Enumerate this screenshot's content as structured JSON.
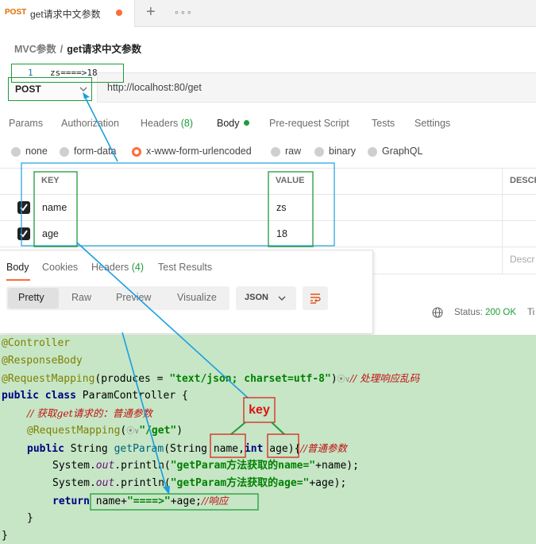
{
  "tab": {
    "method": "POST",
    "title": "get请求中文参数",
    "plus": "+",
    "more": "∘∘∘"
  },
  "breadcrumb": {
    "parent": "MVC参数",
    "separator": "/",
    "current": "get请求中文参数"
  },
  "request": {
    "method": "POST",
    "url": "http://localhost:80/get",
    "tabs": [
      {
        "label": "Params"
      },
      {
        "label": "Authorization"
      },
      {
        "label": "Headers",
        "count": "(8)"
      },
      {
        "label": "Body"
      },
      {
        "label": "Pre-request Script"
      },
      {
        "label": "Tests"
      },
      {
        "label": "Settings"
      }
    ],
    "body_types": [
      "none",
      "form-data",
      "x-www-form-urlencoded",
      "raw",
      "binary",
      "GraphQL"
    ],
    "selected_body_type": "x-www-form-urlencoded",
    "table": {
      "headers": {
        "key": "KEY",
        "value": "VALUE",
        "description": "DESCR"
      },
      "rows": [
        {
          "key": "name",
          "value": "zs",
          "checked": true
        },
        {
          "key": "age",
          "value": "18",
          "checked": true
        }
      ],
      "description_placeholder": "Descr"
    }
  },
  "response": {
    "tabs": [
      {
        "label": "Body"
      },
      {
        "label": "Cookies"
      },
      {
        "label": "Headers",
        "count": "(4)"
      },
      {
        "label": "Test Results"
      }
    ],
    "views": [
      "Pretty",
      "Raw",
      "Preview",
      "Visualize"
    ],
    "format": "JSON",
    "line_number": "1",
    "output": "zs====>18",
    "status_label": "Status:",
    "status_value": "200 OK",
    "time_label": "Ti"
  },
  "code": {
    "l1": "@Controller",
    "l2": "@ResponseBody",
    "l3_ann": "@RequestMapping",
    "l3_a": "(produces = ",
    "l3_str": "\"text/json; charset=utf-8\"",
    "l3_b": ")",
    "l3_icon": "⦿∨",
    "l3_cmt": "// 处理响应乱码",
    "l4_kw": "public class",
    "l4_rest": " ParamController {",
    "l5_cmt": "// 获取get请求的：普通参数",
    "l6_ann": "@RequestMapping",
    "l6_a": "(",
    "l6_icon": "⦿∨",
    "l6_str": "\"/get\"",
    "l6_b": ")",
    "l7_kw": "public",
    "l7_a": " String ",
    "l7_m": "getParam",
    "l7_b": "(String name,",
    "l7_kw2": "int",
    "l7_c": " age){",
    "l7_cmt": "//普通参数",
    "l8_a": "System.",
    "l8_f": "out",
    "l8_b": ".println(",
    "l8_str": "\"getParam方法获取的name=\"",
    "l8_c": "+name);",
    "l9_a": "System.",
    "l9_f": "out",
    "l9_b": ".println(",
    "l9_str": "\"getParam方法获取的age=\"",
    "l9_c": "+age);",
    "l10_kw": "return",
    "l10_a": " name+",
    "l10_str": "\"====>\"",
    "l10_b": "+age;",
    "l10_cmt": "//响应",
    "l11": "}",
    "l12": "}"
  },
  "annotation": {
    "key_label": "key"
  },
  "colors": {
    "accent": "#ff6c37",
    "annotation_box": "#1f9c3a",
    "arrow": "#1a9fe0",
    "code_bg": "#c6e6c6",
    "key_text": "#e01010"
  }
}
